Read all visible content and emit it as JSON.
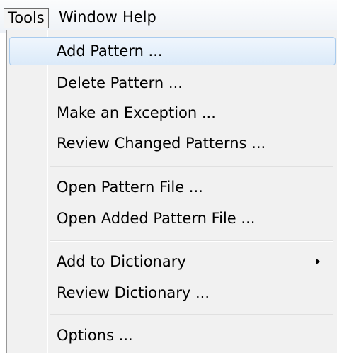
{
  "menubar": {
    "items": [
      {
        "label": "Tools",
        "active": true
      },
      {
        "label": "Window",
        "active": false
      },
      {
        "label": "Help",
        "active": false
      }
    ]
  },
  "dropdown": {
    "items": [
      {
        "label": "Add Pattern ...",
        "highlighted": true
      },
      {
        "label": "Delete Pattern ..."
      },
      {
        "label": "Make an Exception ..."
      },
      {
        "label": "Review Changed Patterns ..."
      },
      {
        "label": "Open Pattern File ..."
      },
      {
        "label": "Open Added Pattern File ..."
      },
      {
        "label": "Add to Dictionary",
        "submenu_icon": "submenu-arrow-icon"
      },
      {
        "label": "Review Dictionary ..."
      },
      {
        "label": "Options ..."
      }
    ]
  },
  "colors": {
    "highlight_bg": "#dbeaf9",
    "highlight_border": "#a9cbed",
    "menu_bg": "#f1f1f1"
  }
}
